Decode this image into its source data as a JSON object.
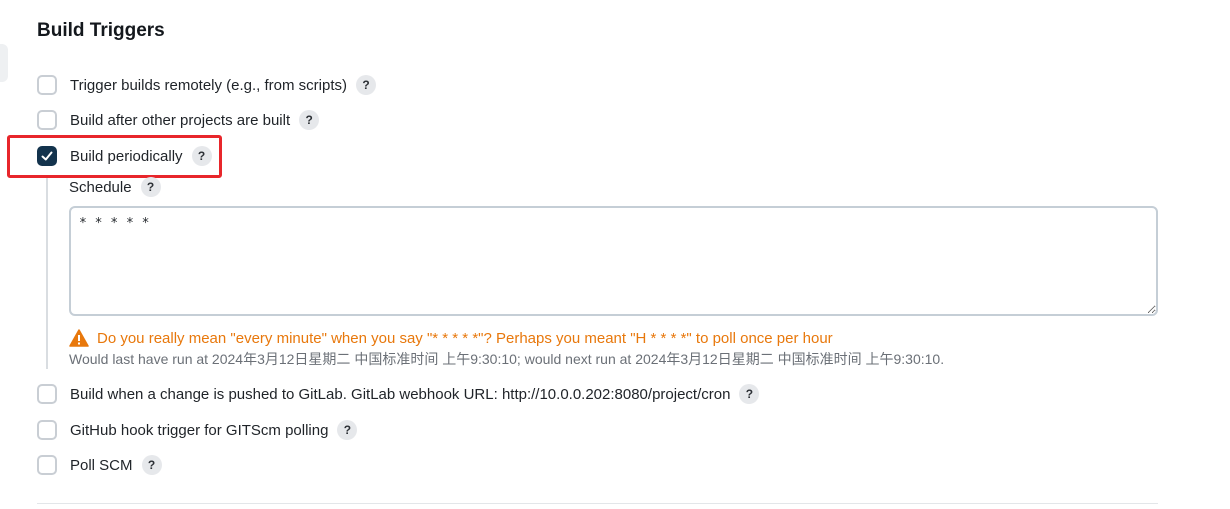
{
  "section": {
    "title": "Build Triggers"
  },
  "triggers": [
    {
      "label": "Trigger builds remotely (e.g., from scripts)",
      "checked": false
    },
    {
      "label": "Build after other projects are built",
      "checked": false
    },
    {
      "label": "Build periodically",
      "checked": true
    },
    {
      "label": "Build when a change is pushed to GitLab. GitLab webhook URL: http://10.0.0.202:8080/project/cron",
      "checked": false
    },
    {
      "label": "GitHub hook trigger for GITScm polling",
      "checked": false
    },
    {
      "label": "Poll SCM",
      "checked": false
    }
  ],
  "help_glyph": "?",
  "schedule": {
    "label": "Schedule",
    "value": "* * * * *",
    "warning": "Do you really mean \"every minute\" when you say \"* * * * *\"? Perhaps you meant \"H * * * *\" to poll once per hour",
    "run_info": "Would last have run at 2024年3月12日星期二 中国标准时间 上午9:30:10; would next run at 2024年3月12日星期二 中国标准时间 上午9:30:10."
  },
  "colors": {
    "checked_fill": "#13334d",
    "warning": "#e8780c",
    "highlight": "#e8262b"
  },
  "icons": {
    "warning": "warning-triangle-icon",
    "check": "check-icon",
    "help": "help-icon"
  }
}
